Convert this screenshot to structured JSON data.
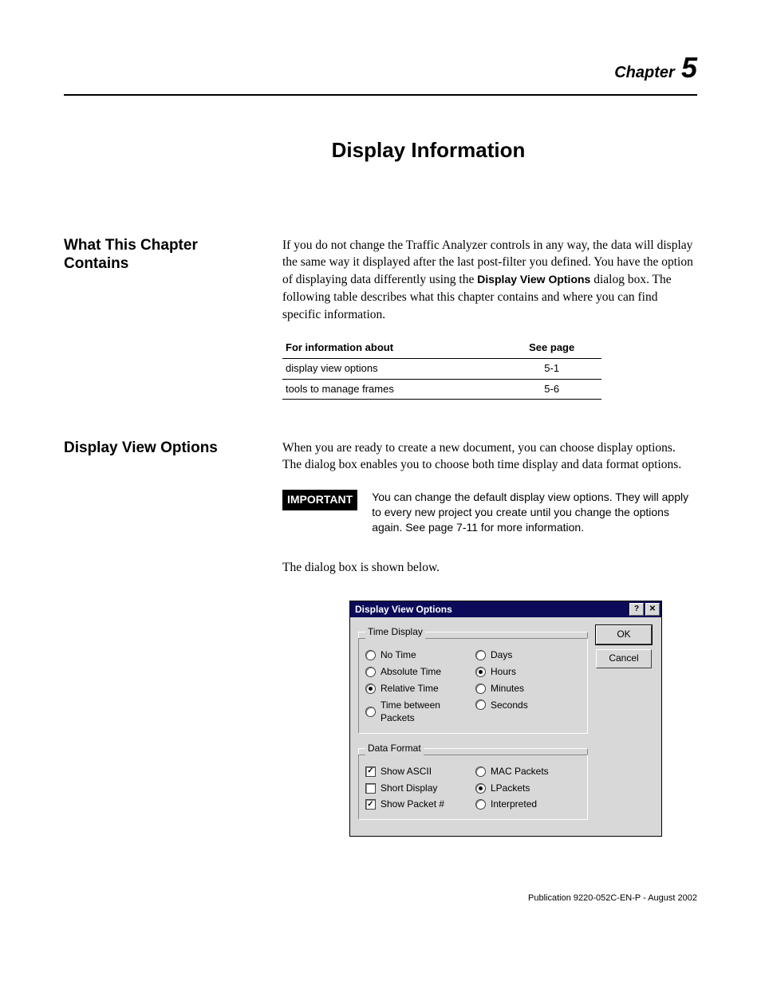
{
  "chapter": {
    "word": "Chapter",
    "number": "5"
  },
  "page_title": "Display Information",
  "sections": {
    "what_contains": {
      "heading": "What This Chapter Contains",
      "para_pre": "If you do not change the Traffic Analyzer controls in any way, the data will display the same way it displayed after the last post-filter you defined. You have the option of displaying data differently using the ",
      "para_bold": "Display View Options",
      "para_post": " dialog box. The following table describes what this chapter contains and where you can find specific information.",
      "table": {
        "h1": "For information about",
        "h2": "See page",
        "rows": [
          {
            "c1": "display view options",
            "c2": "5-1"
          },
          {
            "c1": "tools to manage frames",
            "c2": "5-6"
          }
        ]
      }
    },
    "display_view": {
      "heading": "Display View Options",
      "para1": "When you are ready to create a new document, you can choose display options. The                                   dialog box enables you to choose both time display and data format options.",
      "important_tag": "IMPORTANT",
      "important_text": "You can change the default display view options. They will apply to every new project you create until you change the options again. See page 7-11 for more information.",
      "para2": "The                                           dialog box is shown below."
    }
  },
  "dialog": {
    "title": "Display View Options",
    "help_glyph": "?",
    "close_glyph": "✕",
    "ok_label": "OK",
    "cancel_label": "Cancel",
    "time_display": {
      "legend": "Time Display",
      "left": [
        {
          "label": "No Time",
          "selected": false
        },
        {
          "label": "Absolute Time",
          "selected": false
        },
        {
          "label": "Relative Time",
          "selected": true
        },
        {
          "label": "Time between Packets",
          "selected": false
        }
      ],
      "right": [
        {
          "label": "Days",
          "selected": false
        },
        {
          "label": "Hours",
          "selected": true
        },
        {
          "label": "Minutes",
          "selected": false
        },
        {
          "label": "Seconds",
          "selected": false
        }
      ]
    },
    "data_format": {
      "legend": "Data Format",
      "left": [
        {
          "label": "Show ASCII",
          "checked": true
        },
        {
          "label": "Short Display",
          "checked": false
        },
        {
          "label": "Show Packet #",
          "checked": true
        }
      ],
      "right": [
        {
          "label": "MAC Packets",
          "selected": false
        },
        {
          "label": "LPackets",
          "selected": true
        },
        {
          "label": "Interpreted",
          "selected": false
        }
      ]
    }
  },
  "footer": "Publication 9220-052C-EN-P - August 2002"
}
